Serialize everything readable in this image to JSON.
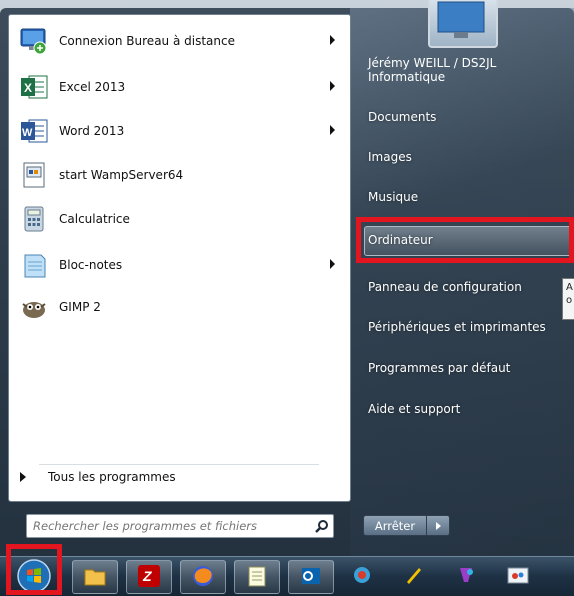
{
  "programs": [
    {
      "label": "Connexion Bureau à distance",
      "icon": "remote-desktop-icon",
      "has_submenu": true
    },
    {
      "label": "Excel 2013",
      "icon": "excel-icon",
      "has_submenu": true
    },
    {
      "label": "Word 2013",
      "icon": "word-icon",
      "has_submenu": true
    },
    {
      "label": "start WampServer64",
      "icon": "wampserver-icon",
      "has_submenu": false
    },
    {
      "label": "Calculatrice",
      "icon": "calculator-icon",
      "has_submenu": false
    },
    {
      "label": "Bloc-notes",
      "icon": "notepad-icon",
      "has_submenu": true
    },
    {
      "label": "GIMP 2",
      "icon": "gimp-icon",
      "has_submenu": false
    }
  ],
  "all_programs_label": "Tous les programmes",
  "search": {
    "placeholder": "Rechercher les programmes et fichiers"
  },
  "user": {
    "line1": "Jérémy WEILL / DS2JL",
    "line2": "Informatique"
  },
  "right_items": [
    "Documents",
    "Images",
    "Musique",
    "Ordinateur",
    "Panneau de configuration",
    "Périphériques et imprimantes",
    "Programmes par défaut",
    "Aide et support"
  ],
  "shutdown_label": "Arrêter",
  "tooltip_text": [
    "A",
    "o"
  ],
  "taskbar_icons": [
    "start-orb-icon",
    "file-explorer-icon",
    "filezilla-icon",
    "firefox-icon",
    "notepad-icon",
    "outlook-icon",
    "network-icon",
    "pen-icon",
    "color-icon",
    "paint-icon"
  ],
  "colors": {
    "highlight_red": "#e3161f",
    "excel_green": "#1e7145",
    "word_blue": "#2b579a",
    "filezilla_red": "#bf0000"
  }
}
